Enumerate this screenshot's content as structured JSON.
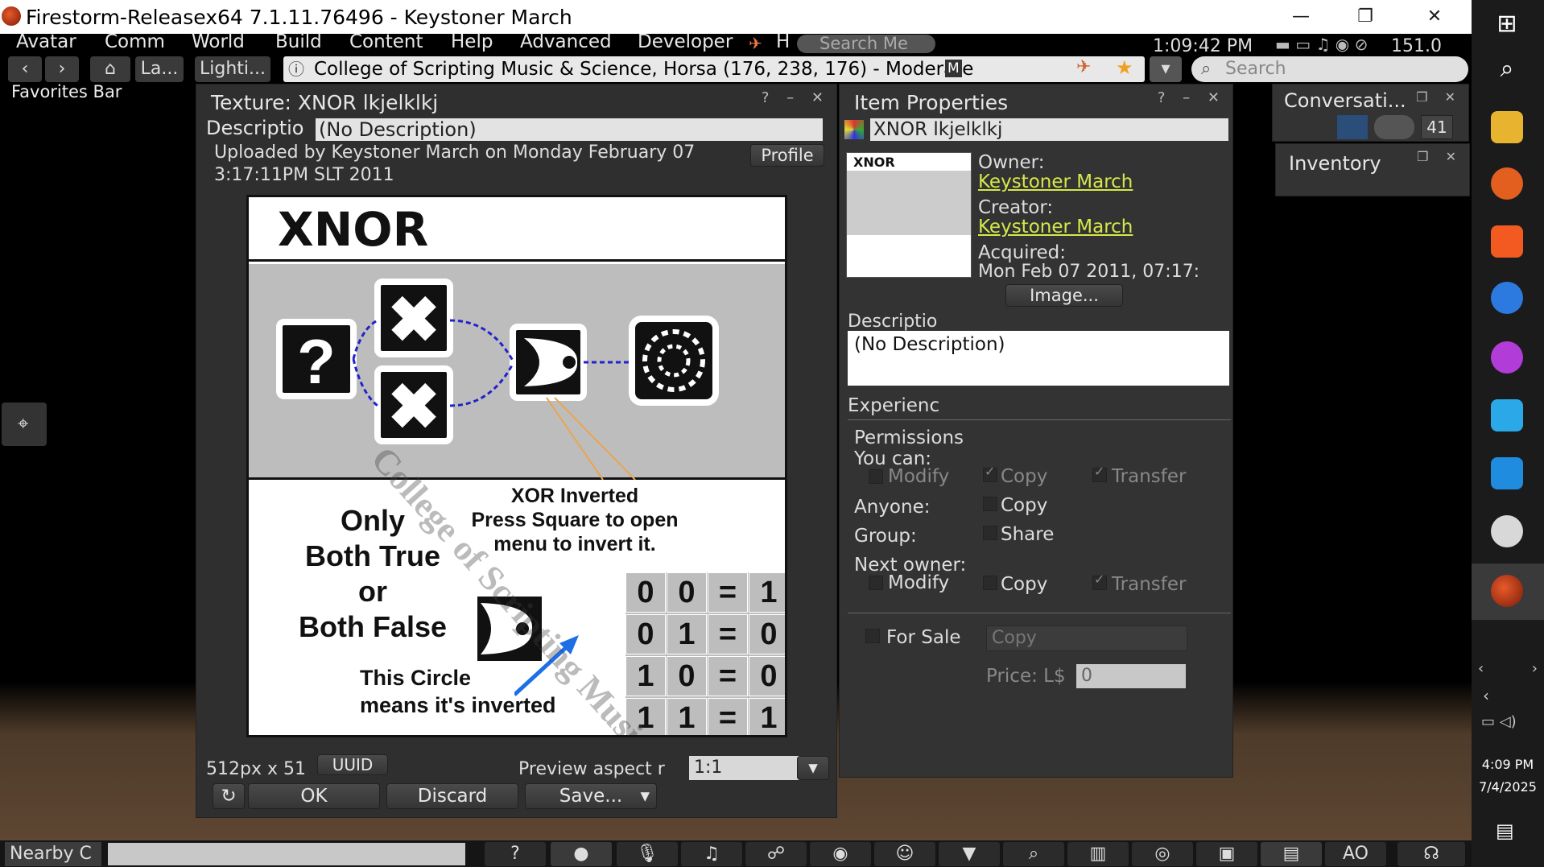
{
  "window": {
    "title": "Firestorm-Releasex64 7.1.11.76496 - Keystoner March"
  },
  "menu": {
    "items": [
      "Avatar",
      "Comm",
      "World",
      "Build",
      "Content",
      "Help",
      "Advanced",
      "Developer"
    ],
    "h_label": "H",
    "search_placeholder": "Search Me",
    "clock": "1:09:42 PM",
    "balance": "151.0"
  },
  "nav": {
    "btn_la": "La...",
    "btn_lighting": "Lighti...",
    "location": "College of Scripting Music & Science, Horsa (176, 238, 176) - Moderate",
    "maturity_badge": "M",
    "search_placeholder": "Search"
  },
  "favorites_bar": "Favorites Bar",
  "texture": {
    "title": "Texture: XNOR lkjelklkj",
    "desc_label": "Descriptio",
    "desc_value": "(No Description)",
    "uploaded_line1": "Uploaded by Keystoner March on Monday February 07",
    "uploaded_line2": "3:17:11PM SLT 2011",
    "profile_label": "Profile",
    "image": {
      "heading": "XNOR",
      "note_line1": "XOR Inverted",
      "note_line2": "Press Square to open",
      "note_line3": "menu to invert it.",
      "caption_line1": "Only",
      "caption_line2": "Both True",
      "caption_line3": "or",
      "caption_line4": "Both False",
      "circle_line1": "This Circle",
      "circle_line2": "means it's inverted",
      "watermark": "College of Scripting Music and Science",
      "truth_table": [
        [
          "0",
          "0",
          "=",
          "1"
        ],
        [
          "0",
          "1",
          "=",
          "0"
        ],
        [
          "1",
          "0",
          "=",
          "0"
        ],
        [
          "1",
          "1",
          "=",
          "1"
        ]
      ]
    },
    "size_label": "512px x 51",
    "uuid_label": "UUID",
    "aspect_label": "Preview aspect r",
    "aspect_value": "1:1",
    "ok_label": "OK",
    "discard_label": "Discard",
    "save_label": "Save..."
  },
  "props": {
    "title": "Item Properties",
    "name": "XNOR lkjelklkj",
    "owner_label": "Owner:",
    "owner": "Keystoner March",
    "creator_label": "Creator:",
    "creator": "Keystoner March",
    "acquired_label": "Acquired:",
    "acquired": "Mon Feb 07 2011, 07:17:",
    "image_btn": "Image...",
    "desc_label": "Descriptio",
    "desc_value": "(No Description)",
    "experience_label": "Experienc",
    "permissions_label": "Permissions",
    "you_can_label": "You can:",
    "modify_label": "Modify",
    "copy_label": "Copy",
    "transfer_label": "Transfer",
    "anyone_label": "Anyone:",
    "group_label": "Group:",
    "share_label": "Share",
    "next_owner_label": "Next owner:",
    "for_sale_label": "For Sale",
    "sale_type": "Copy",
    "price_label": "Price: L$",
    "price_value": "0",
    "thumb_heading": "XNOR"
  },
  "conversations": {
    "title": "Conversati...",
    "count": "41"
  },
  "inventory": {
    "title": "Inventory"
  },
  "bottom": {
    "chat_label": "Nearby C",
    "ao_label": "AO"
  },
  "system": {
    "time": "4:09 PM",
    "date": "7/4/2025"
  },
  "colors": {
    "link": "#d6e84a",
    "panel": "#333333",
    "floor": "#5e4632"
  }
}
